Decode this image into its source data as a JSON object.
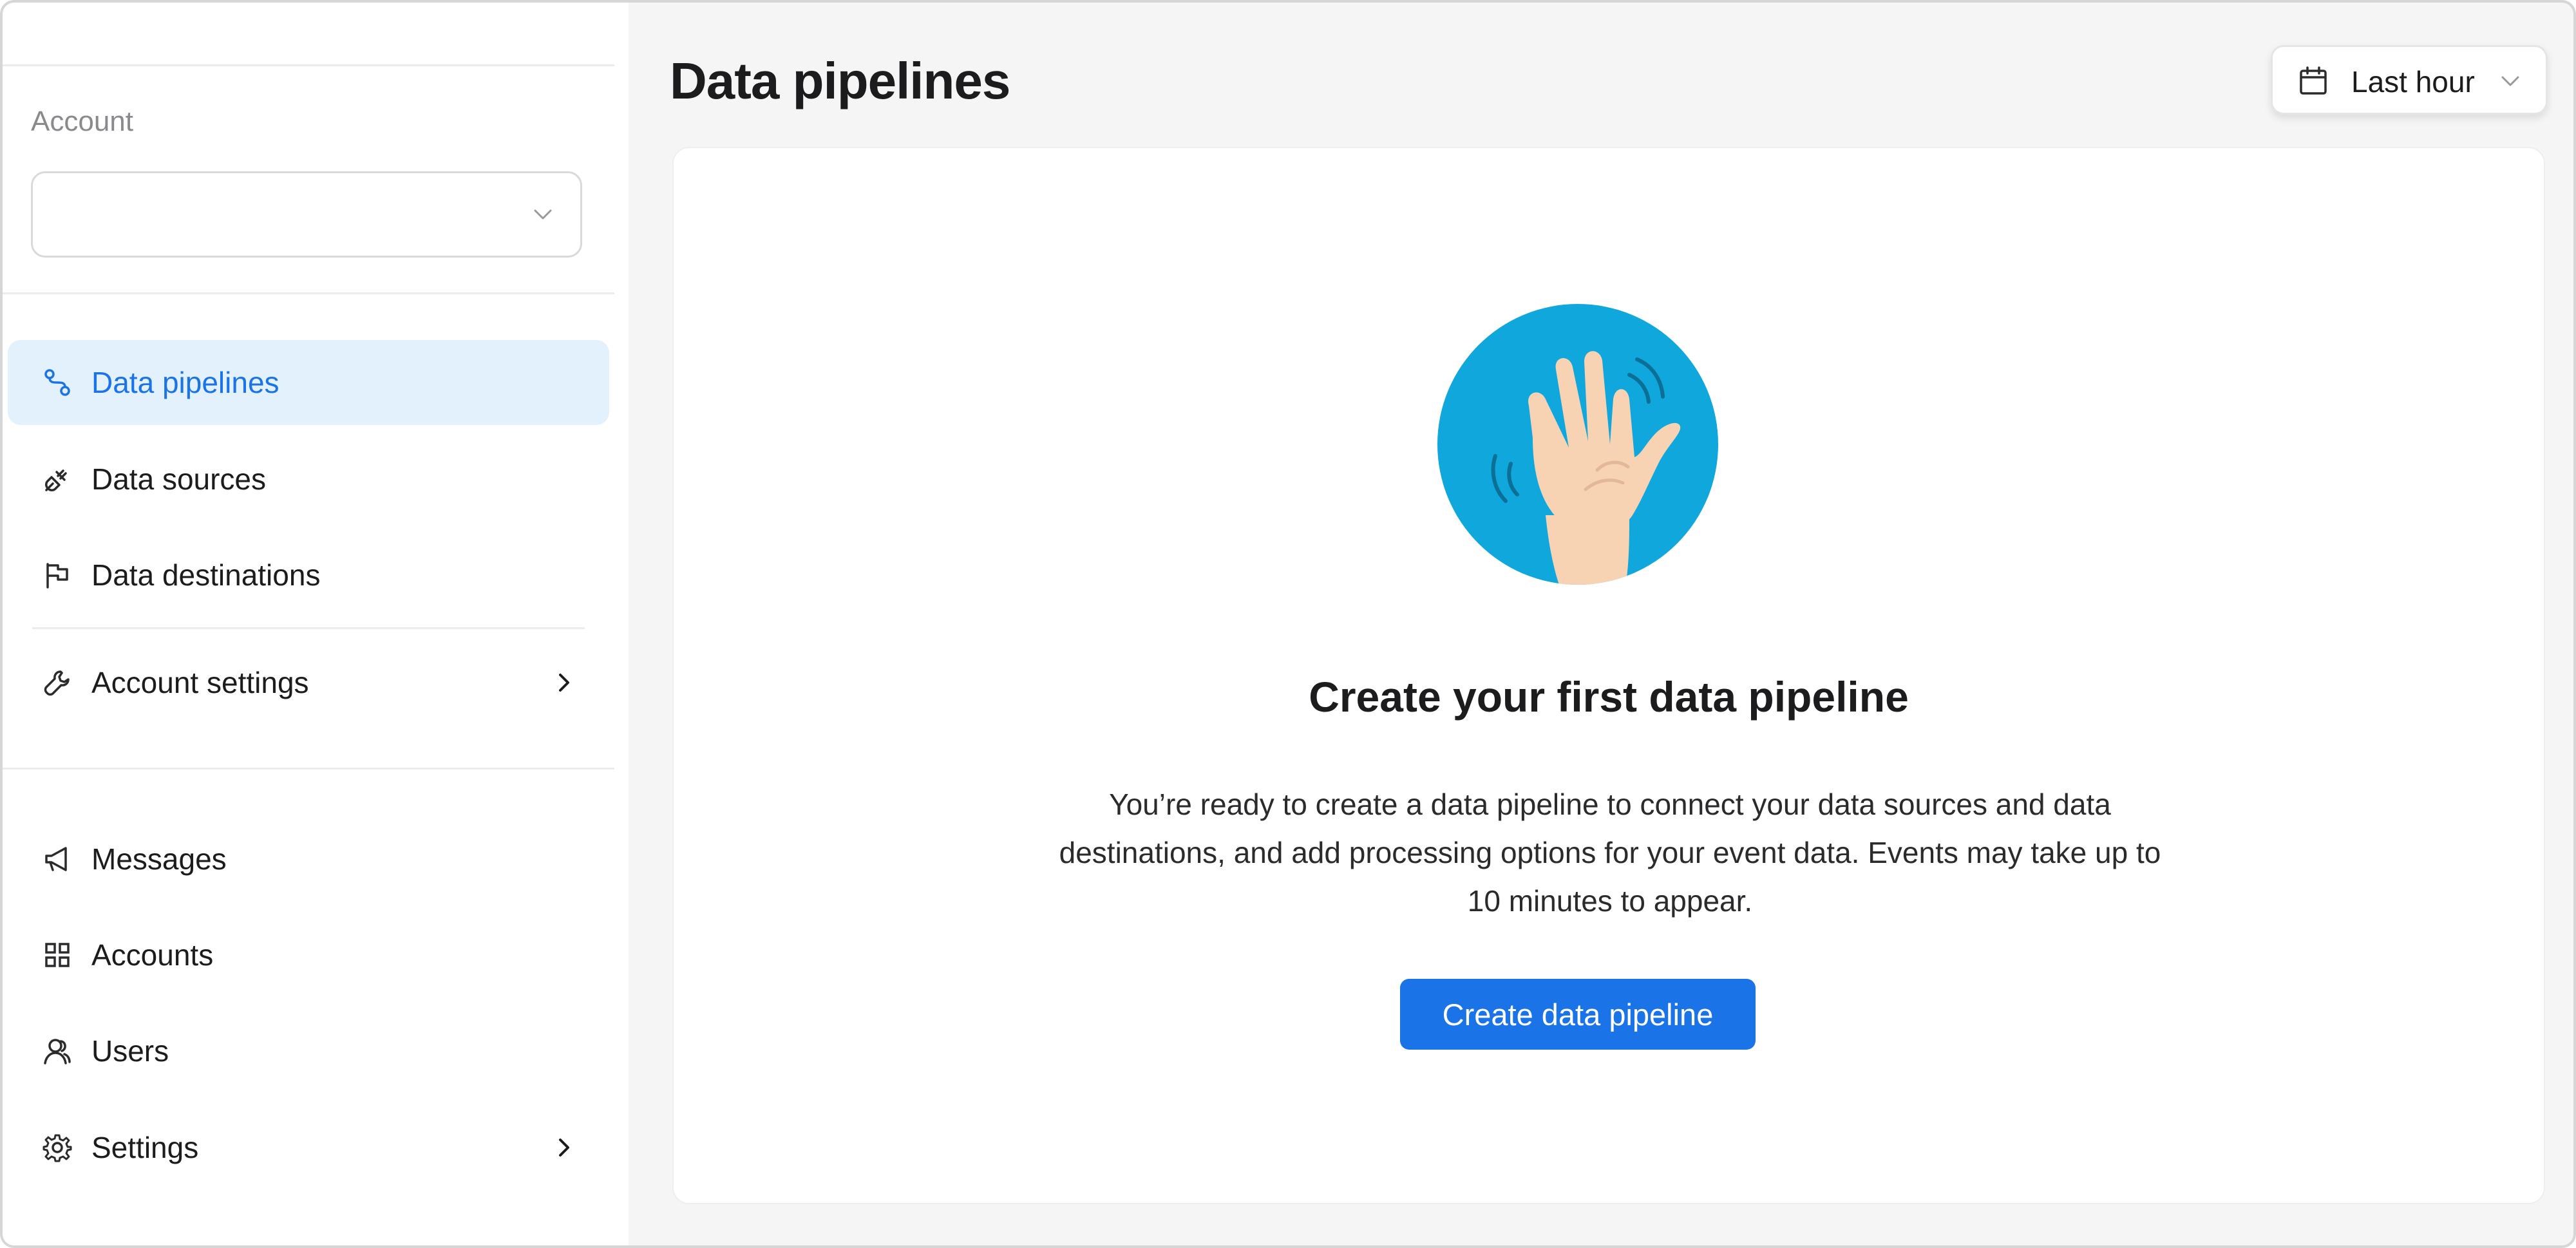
{
  "account": {
    "label": "Account",
    "selected": ""
  },
  "nav": {
    "primary": [
      {
        "label": "Data pipelines",
        "icon": "pipeline-icon",
        "active": true
      },
      {
        "label": "Data sources",
        "icon": "plug-icon"
      },
      {
        "label": "Data destinations",
        "icon": "flag-icon"
      },
      {
        "label": "Account settings",
        "icon": "wrench-icon",
        "has_submenu": true
      }
    ],
    "secondary": [
      {
        "label": "Messages",
        "icon": "megaphone-icon"
      },
      {
        "label": "Accounts",
        "icon": "grid-icon"
      },
      {
        "label": "Users",
        "icon": "users-icon"
      },
      {
        "label": "Settings",
        "icon": "gear-icon",
        "has_submenu": true
      }
    ]
  },
  "header": {
    "title": "Data pipelines",
    "time_range": "Last hour"
  },
  "empty_state": {
    "title": "Create your first data pipeline",
    "description": "You’re ready to create a data pipeline to connect your data sources and data destinations, and add processing options for your event data. Events may take up to 10 minutes to appear.",
    "button_label": "Create data pipeline",
    "illustration": "waving-hand-illustration"
  },
  "colors": {
    "accent": "#1a74e8",
    "active_nav_bg": "#e3f1fd",
    "illustration_circle": "#0fa7dc",
    "skin": "#f7d3b4"
  }
}
